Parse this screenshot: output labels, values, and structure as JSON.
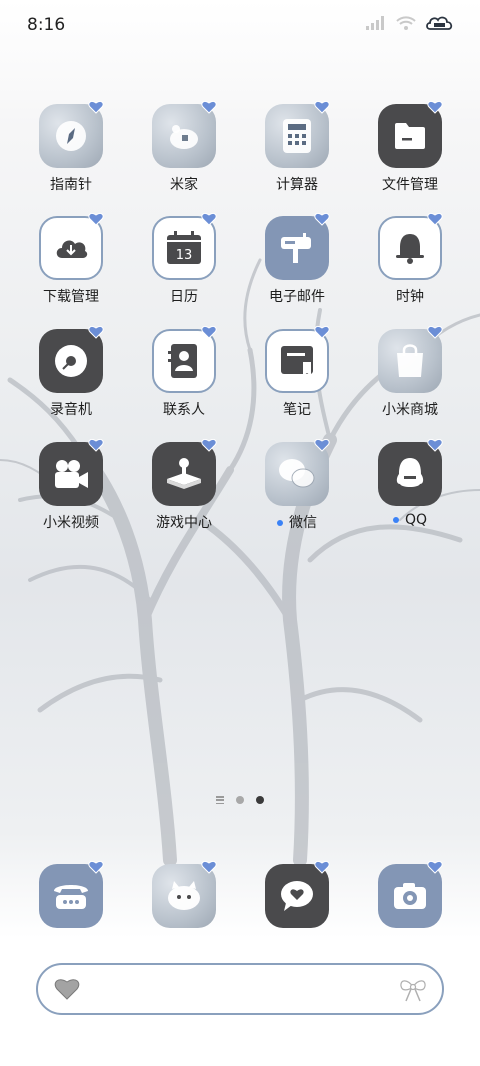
{
  "status": {
    "time": "8:16"
  },
  "apps": [
    {
      "label": "指南针",
      "icon": "compass-icon",
      "dot": false
    },
    {
      "label": "米家",
      "icon": "mijia-icon",
      "dot": false
    },
    {
      "label": "计算器",
      "icon": "calculator-icon",
      "dot": false
    },
    {
      "label": "文件管理",
      "icon": "folder-icon",
      "dot": false
    },
    {
      "label": "下载管理",
      "icon": "cloud-download-icon",
      "dot": false
    },
    {
      "label": "日历",
      "icon": "calendar-icon",
      "dot": false,
      "day": "13"
    },
    {
      "label": "电子邮件",
      "icon": "mailbox-icon",
      "dot": false
    },
    {
      "label": "时钟",
      "icon": "bell-icon",
      "dot": false
    },
    {
      "label": "录音机",
      "icon": "recorder-disc-icon",
      "dot": false
    },
    {
      "label": "联系人",
      "icon": "contacts-icon",
      "dot": false
    },
    {
      "label": "笔记",
      "icon": "notes-icon",
      "dot": false
    },
    {
      "label": "小米商城",
      "icon": "shopping-bag-icon",
      "dot": false
    },
    {
      "label": "小米视频",
      "icon": "video-camera-icon",
      "dot": false
    },
    {
      "label": "游戏中心",
      "icon": "joystick-icon",
      "dot": false
    },
    {
      "label": "微信",
      "icon": "wechat-icon",
      "dot": true
    },
    {
      "label": "QQ",
      "icon": "qq-penguin-icon",
      "dot": true
    }
  ],
  "dock": [
    {
      "icon": "phone-icon"
    },
    {
      "icon": "messages-cat-icon"
    },
    {
      "icon": "chat-heart-icon"
    },
    {
      "icon": "camera-icon"
    }
  ],
  "search": {
    "left_icon": "heart-icon",
    "right_icon": "bow-icon"
  },
  "page_indicator": {
    "pages": 2,
    "active": 2
  },
  "colors": {
    "accent": "#3b82f6",
    "icon_dark": "#4a4a4c",
    "icon_blue": "#8396b5",
    "outline": "#8aa0bd"
  }
}
